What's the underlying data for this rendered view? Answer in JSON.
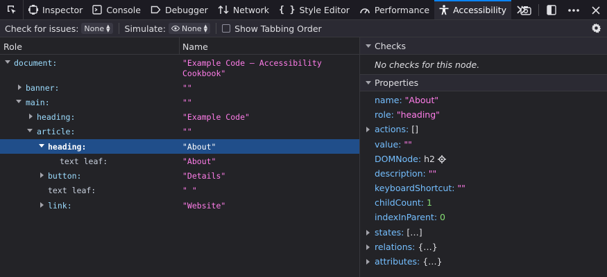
{
  "toolbar": {
    "tabs": [
      {
        "label": "Inspector",
        "icon": "inspector-icon"
      },
      {
        "label": "Console",
        "icon": "console-icon"
      },
      {
        "label": "Debugger",
        "icon": "debugger-icon"
      },
      {
        "label": "Network",
        "icon": "network-icon"
      },
      {
        "label": "Style Editor",
        "icon": "style-editor-icon"
      },
      {
        "label": "Performance",
        "icon": "performance-icon"
      },
      {
        "label": "Accessibility",
        "icon": "accessibility-icon",
        "selected": true
      }
    ],
    "accent": "#0a84ff"
  },
  "filterbar": {
    "check_label": "Check for issues:",
    "check_value": "None",
    "simulate_label": "Simulate:",
    "simulate_value": "None",
    "tabbing_label": "Show Tabbing Order"
  },
  "tree": {
    "col_role": "Role",
    "col_name": "Name",
    "rows": [
      {
        "role": "document:",
        "name": "\"Example Code – Accessibility",
        "name2": "Cookbook\""
      },
      {
        "role": "banner:",
        "name": "\"\""
      },
      {
        "role": "main:",
        "name": "\"\""
      },
      {
        "role": "heading:",
        "name": "\"Example Code\""
      },
      {
        "role": "article:",
        "name": "\"\""
      },
      {
        "role": "heading:",
        "name": "\"About\""
      },
      {
        "role": "text leaf:",
        "name": "\"About\""
      },
      {
        "role": "button:",
        "name": "\"Details\""
      },
      {
        "role": "text leaf:",
        "name": "\" \""
      },
      {
        "role": "link:",
        "name": "\"Website\""
      }
    ]
  },
  "sidebar": {
    "checks_title": "Checks",
    "no_checks": "No checks for this node.",
    "properties_title": "Properties",
    "props": [
      {
        "key": "name:",
        "value": "\"About\""
      },
      {
        "key": "role:",
        "value": "\"heading\""
      },
      {
        "key": "actions:",
        "value": "[]"
      },
      {
        "key": "value:",
        "value": "\"\""
      },
      {
        "key": "DOMNode:",
        "value": "h2"
      },
      {
        "key": "description:",
        "value": "\"\""
      },
      {
        "key": "keyboardShortcut:",
        "value": "\"\""
      },
      {
        "key": "childCount:",
        "value": "1"
      },
      {
        "key": "indexInParent:",
        "value": "0"
      },
      {
        "key": "states:",
        "value": "[…]"
      },
      {
        "key": "relations:",
        "value": "{…}"
      },
      {
        "key": "attributes:",
        "value": "{…}"
      }
    ]
  }
}
